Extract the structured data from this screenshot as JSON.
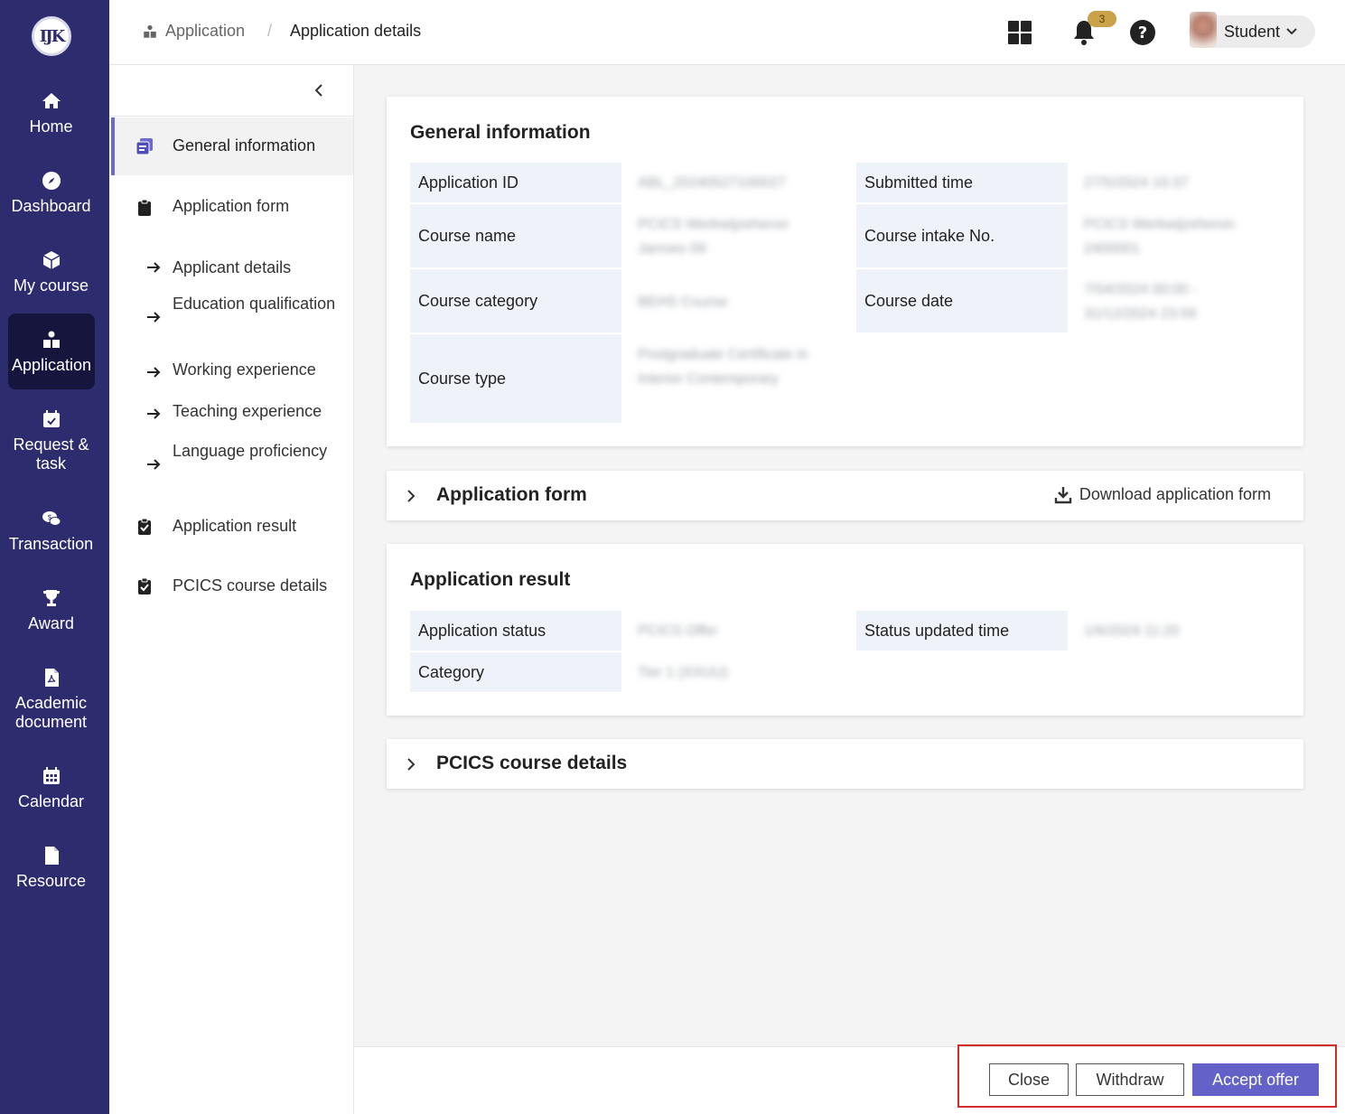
{
  "rail": {
    "logo_text": "IJK",
    "items": [
      {
        "label": "Home",
        "icon": "home-icon"
      },
      {
        "label": "Dashboard",
        "icon": "compass-icon"
      },
      {
        "label": "My course",
        "icon": "cube-icon"
      },
      {
        "label": "Application",
        "icon": "application-icon",
        "active": true
      },
      {
        "label": "Request & task",
        "icon": "calendar-check-icon"
      },
      {
        "label": "Transaction",
        "icon": "chat-money-icon"
      },
      {
        "label": "Award",
        "icon": "trophy-icon"
      },
      {
        "label": "Academic document",
        "icon": "pdf-file-icon"
      },
      {
        "label": "Calendar",
        "icon": "calendar-icon"
      },
      {
        "label": "Resource",
        "icon": "file-icon"
      }
    ]
  },
  "header": {
    "breadcrumb_root": "Application",
    "breadcrumb_separator": "/",
    "breadcrumb_current": "Application details",
    "notification_count": "3",
    "user_name": "Student"
  },
  "subnav": {
    "items": [
      {
        "label": "General information",
        "icon": "document-stack-icon",
        "active": true
      },
      {
        "label": "Application form",
        "icon": "clipboard-icon"
      },
      {
        "label": "Applicant details",
        "icon": "arrow-right-icon"
      },
      {
        "label": "Education qualification",
        "icon": "arrow-right-icon"
      },
      {
        "label": "Working experience",
        "icon": "arrow-right-icon"
      },
      {
        "label": "Teaching experience",
        "icon": "arrow-right-icon"
      },
      {
        "label": "Language proficiency",
        "icon": "arrow-right-icon"
      },
      {
        "label": "Application result",
        "icon": "clipboard-check-icon"
      },
      {
        "label": "PCICS course details",
        "icon": "clipboard-check-icon"
      }
    ]
  },
  "general": {
    "title": "General information",
    "labels": {
      "application_id": "Application ID",
      "submitted_time": "Submitted time",
      "course_name": "Course name",
      "course_intake": "Course intake No.",
      "course_category": "Course category",
      "course_date": "Course date",
      "course_type": "Course type"
    },
    "values": {
      "application_id": "ABL_20240527100027",
      "submitted_time": "27/5/2024 10:37",
      "course_name": "PCICS Werkwijzeheron Jarroes 09",
      "course_intake": "PCICS Werkwijzeheron 2400001",
      "course_category": "BEHS Course",
      "course_date": "7/04/2024 00:00 - 31/12/2024 23:59",
      "course_type": "Postgraduate Certificate in Interior Contemporary"
    }
  },
  "application_form": {
    "title": "Application form",
    "download_label": "Download application form"
  },
  "result": {
    "title": "Application result",
    "labels": {
      "status": "Application status",
      "status_time": "Status updated time",
      "category": "Category"
    },
    "values": {
      "status": "PCICS Offer",
      "status_time": "1/6/2024 11:20",
      "category": "Tier 1 (XXUU)"
    }
  },
  "pcics": {
    "title": "PCICS course details"
  },
  "footer": {
    "close_label": "Close",
    "withdraw_label": "Withdraw",
    "accept_label": "Accept offer"
  }
}
